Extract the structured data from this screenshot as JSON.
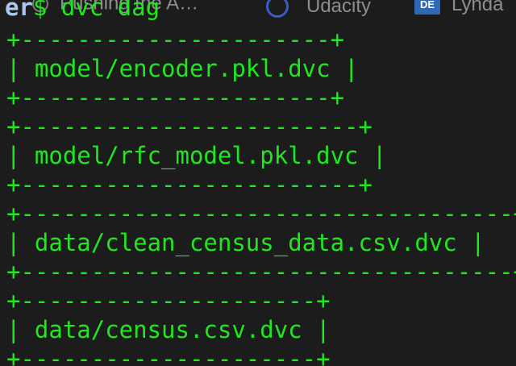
{
  "bookmarks_bar": {
    "items": [
      {
        "label": "Pushing the A…",
        "icon": "circle-icon"
      },
      {
        "label": "Udacity",
        "icon": "udacity-icon"
      },
      {
        "label": "Lynda",
        "icon": "lynda-icon",
        "icon_text": "DE"
      }
    ]
  },
  "terminal": {
    "prompt_prefix": "er",
    "prompt_symbol": "$",
    "command": " dvc dag",
    "stages": [
      {
        "top": "+----------------------+",
        "middle": "| model/encoder.pkl.dvc |",
        "bottom": "+----------------------+"
      },
      {
        "top": "+------------------------+",
        "middle": "| model/rfc_model.pkl.dvc |",
        "bottom": "+------------------------+"
      },
      {
        "top": "+-----------------------------------+",
        "middle": "| data/clean_census_data.csv.dvc |",
        "bottom": "+-----------------------------------+"
      },
      {
        "top": "+---------------------+",
        "middle": "| data/census.csv.dvc |",
        "bottom": "+---------------------+"
      }
    ]
  },
  "colors": {
    "background": "#1c1c1c",
    "terminal_text": "#1ee81e",
    "prompt_prefix": "#a9c8ef",
    "bookmark_text": "#8e8e8e"
  }
}
